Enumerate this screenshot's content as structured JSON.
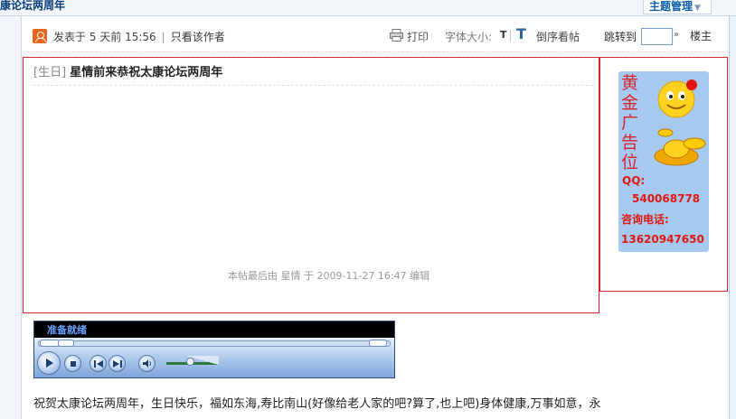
{
  "header": {
    "title": "康论坛两周年",
    "manage_label": "主题管理"
  },
  "toolbar": {
    "posted": "发表于 5 天前 15:56",
    "separator": "|",
    "only_author": "只看该作者",
    "print": "打印",
    "font_size": "字体大小:",
    "font_size_t": "T",
    "reverse_icon": "T",
    "reverse": "倒序看帖",
    "jump_to": "跳转到",
    "jump_value": "",
    "jump_go": "»",
    "floor": "楼主"
  },
  "post": {
    "tag": "[生日]",
    "title": "星情前来恭祝太康论坛两周年",
    "edit_note": "本帖最后由 星情 于 2009-11-27 16:47 编辑",
    "body": "祝贺太康论坛两周年，生日快乐，福如东海,寿比南山(好像给老人家的吧?算了,也上吧)身体健康,万事如意，永"
  },
  "ad": {
    "gold_text": "黄金广告位",
    "qq_label": "QQ:",
    "qq": "540068778",
    "tel_label": "咨询电话:",
    "tel": "13620947650"
  },
  "player": {
    "status": "准备就绪"
  },
  "icons": [
    "author-icon",
    "print-icon",
    "reverse-order-icon",
    "play-icon",
    "stop-icon",
    "previous-icon",
    "next-icon",
    "mute-icon",
    "smiley-icon",
    "gold-ingot-icon"
  ],
  "colors": {
    "frame_red": "#d9242c",
    "link_blue": "#0a5ca8",
    "ad_bg": "#a5c9ef",
    "player_blue": "#4d7fbf"
  }
}
